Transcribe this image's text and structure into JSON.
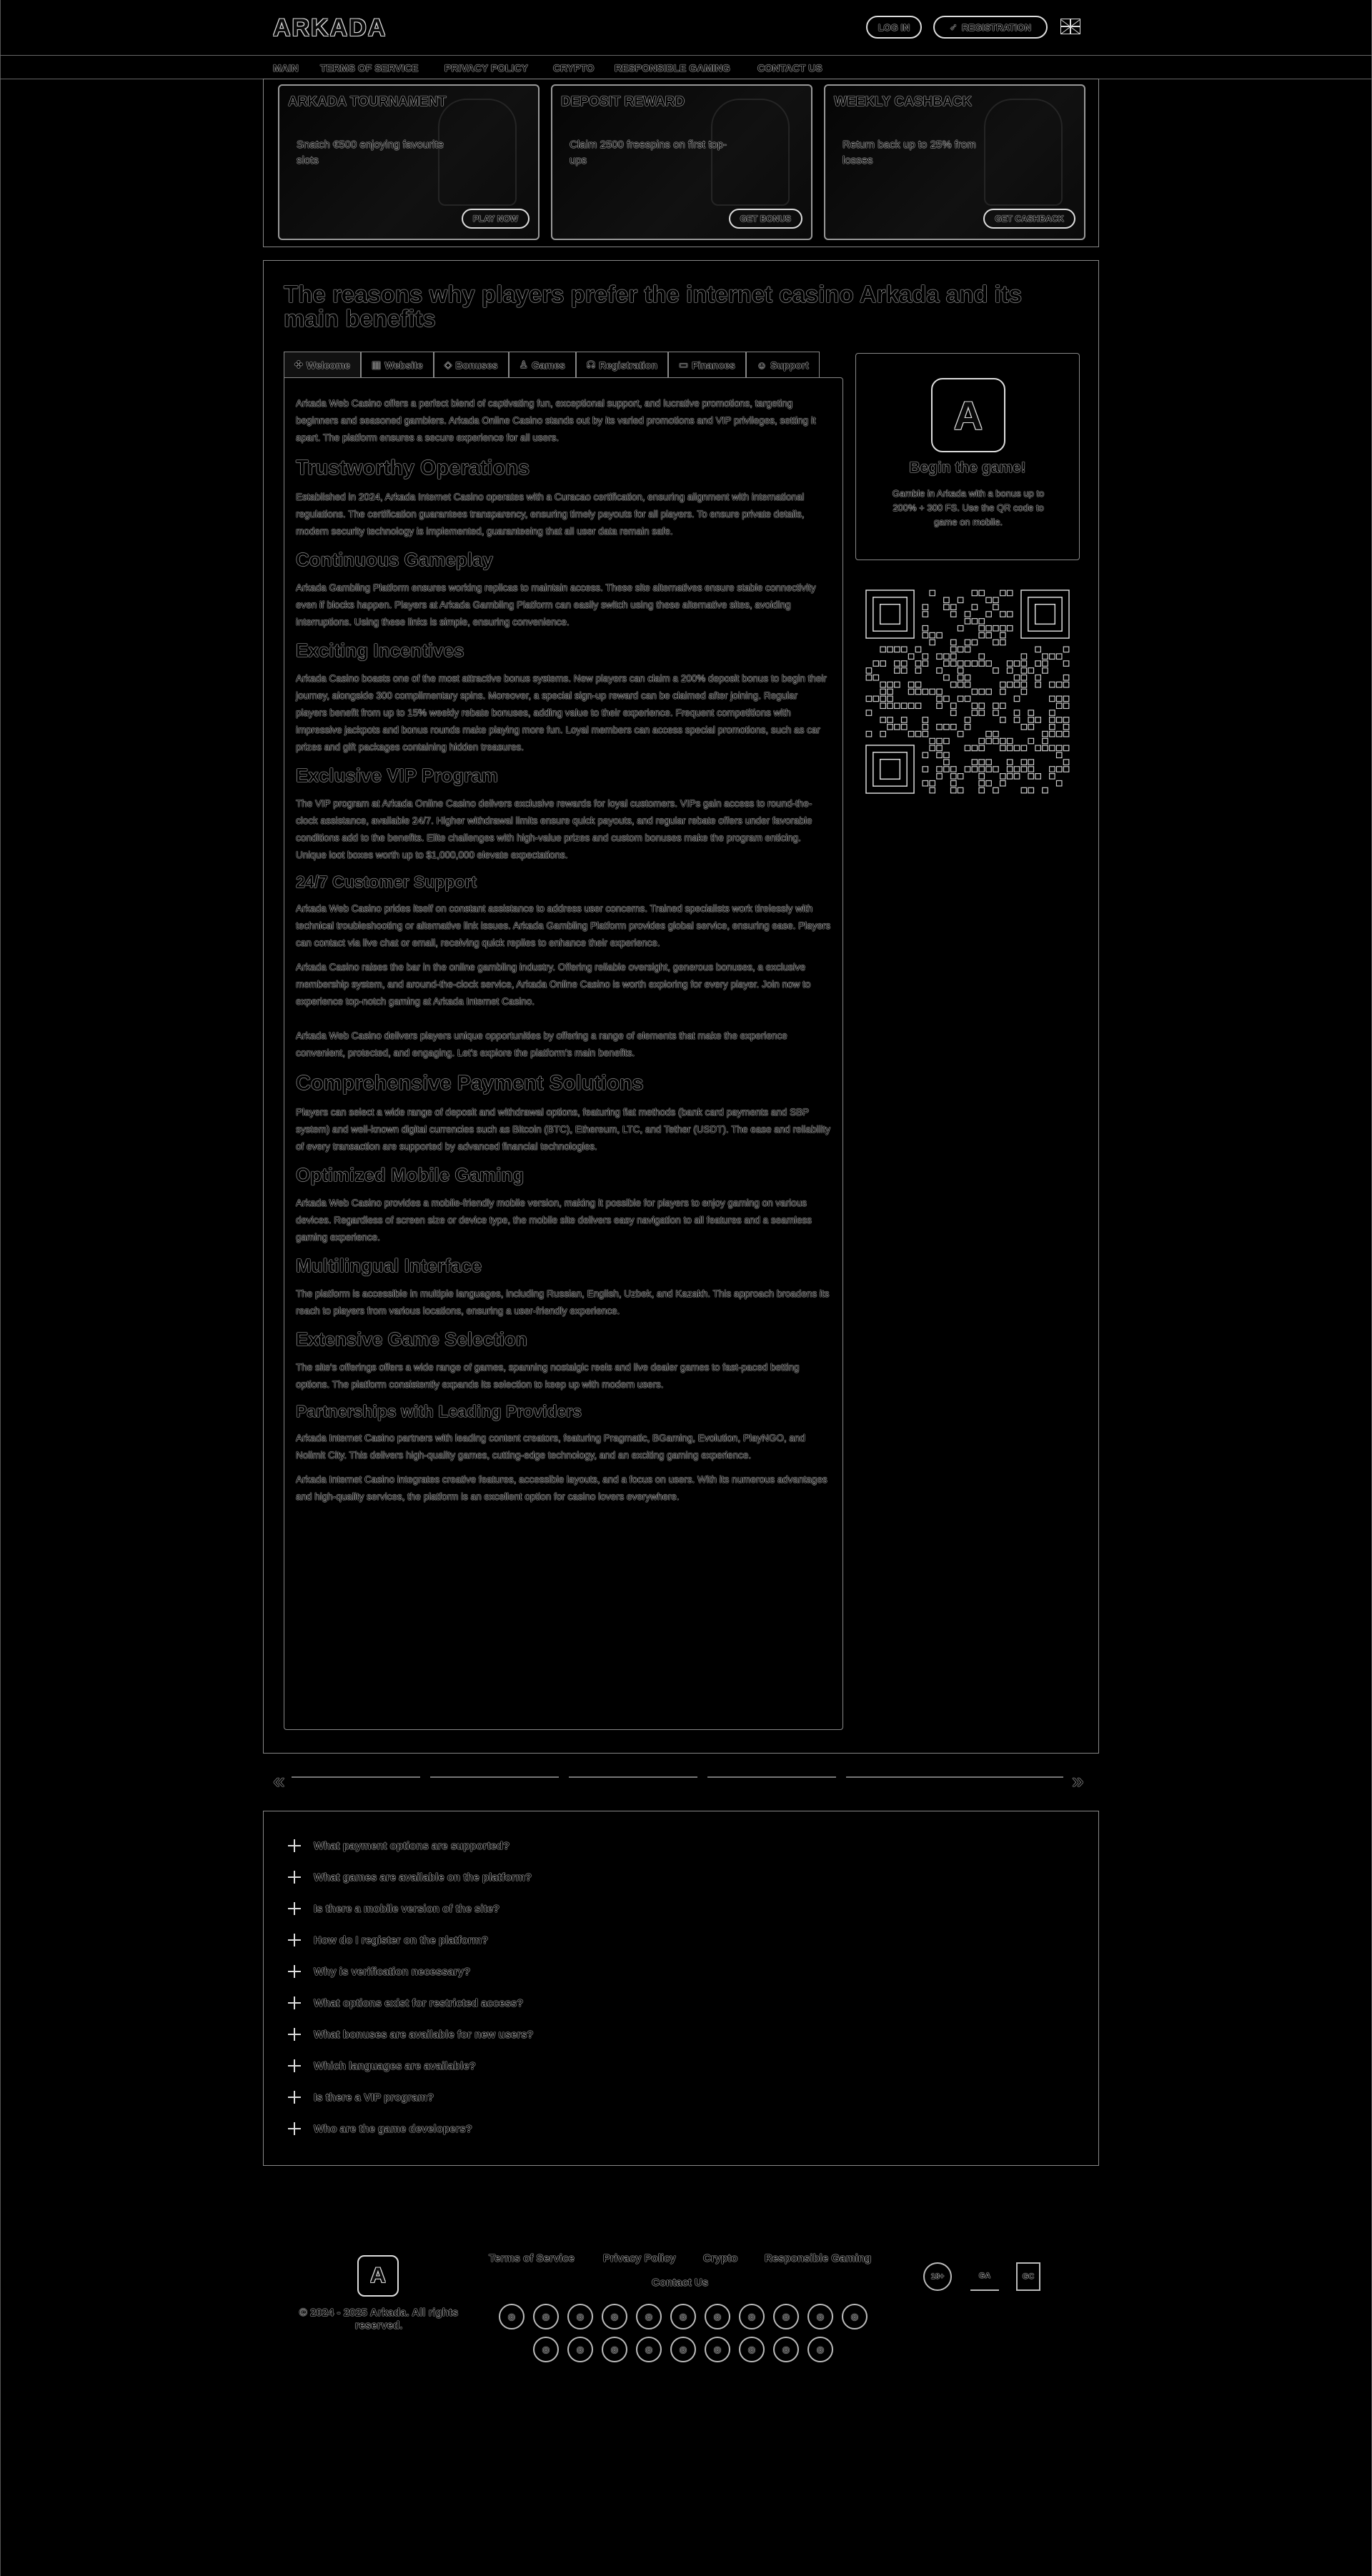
{
  "header": {
    "logo": "ARKADA",
    "login": "LOG IN",
    "register": "REGISTRATION"
  },
  "nav": {
    "items": [
      "Main",
      "Terms of Service",
      "Privacy Policy",
      "Crypto",
      "Responsible Gaming",
      "Contact Us"
    ]
  },
  "promos": [
    {
      "title": "ARKADA TOURNAMENT",
      "desc": "Snatch €500 enjoying favourite slots",
      "button": "PLAY NOW"
    },
    {
      "title": "DEPOSIT REWARD",
      "desc": "Claim 2500 freespins on first top-ups",
      "button": "GET BONUS"
    },
    {
      "title": "WEEKLY CASHBACK",
      "desc": "Return back up to 25% from losses",
      "button": "GET CASHBACK"
    }
  ],
  "main": {
    "title": "The reasons why players prefer the internet casino Arkada and its main benefits",
    "tabs": [
      "Welcome",
      "Website",
      "Bonuses",
      "Games",
      "Registration",
      "Finances",
      "Support"
    ],
    "intro": "Arkada Web Casino offers a perfect blend of captivating fun, exceptional support, and lucrative promotions, targeting beginners and seasoned gamblers. Arkada Online Casino stands out by its varied promotions and VIP privileges, setting it apart. The platform ensures a secure experience for all users.",
    "h_trust": "Trustworthy Operations",
    "p_trust": "Established in 2024, Arkada Internet Casino operates with a Curacao certification, ensuring alignment with international regulations. The certification guarantees transparency, ensuring timely payouts for all players. To ensure private details, modern security technology is implemented, guaranteeing that all user data remain safe.",
    "h_cont": "Continuous Gameplay",
    "p_cont": "Arkada Gambling Platform ensures working replicas to maintain access. These site alternatives ensure stable connectivity even if blocks happen. Players at Arkada Gambling Platform can easily switch using these alternative sites, avoiding interruptions. Using these links is simple, ensuring convenience.",
    "h_exc": "Exciting Incentives",
    "p_exc": "Arkada Casino boasts one of the most attractive bonus systems. New players can claim a 200% deposit bonus to begin their journey, alongside 300 complimentary spins. Moreover, a special sign-up reward can be claimed after joining. Regular players benefit from up to 15% weekly rebate bonuses, adding value to their experience. Frequent competitions with impressive jackpots and bonus rounds make playing more fun. Loyal members can access special promotions, such as car prizes and gift packages containing hidden treasures.",
    "h_vip": "Exclusive VIP Program",
    "p_vip": "The VIP program at Arkada Online Casino delivers exclusive rewards for loyal customers. VIPs gain access to round-the-clock assistance, available 24/7. Higher withdrawal limits ensure quick payouts, and regular rebate offers under favorable conditions add to the benefits. Elite challenges with high-value prizes and custom bonuses make the program enticing. Unique loot boxes worth up to $1,000,000 elevate expectations.",
    "h_sup": "24/7 Customer Support",
    "p_sup": "Arkada Web Casino prides itself on constant assistance to address user concerns. Trained specialists work tirelessly with technical troubleshooting or alternative link issues. Arkada Gambling Platform provides global service, ensuring ease. Players can contact via live chat or email, receiving quick replies to enhance their experience.",
    "p_bar": "Arkada Casino raises the bar in the online gambling industry. Offering reliable oversight, generous bonuses, a exclusive membership system, and around-the-clock service, Arkada Online Casino is worth exploring for every player. Join now to experience top-notch gaming at Arkada Internet Casino.",
    "p_uniq": "Arkada Web Casino delivers players unique opportunities by offering a range of elements that make the experience convenient, protected, and engaging. Let's explore the platform's main benefits.",
    "h_pay": "Comprehensive Payment Solutions",
    "p_pay": "Players can select a wide range of deposit and withdrawal options, featuring fiat methods (bank card payments and SBP system) and well-known digital currencies such as Bitcoin (BTC), Ethereum, LTC, and Tether (USDT). The ease and reliability of every transaction are supported by advanced financial technologies.",
    "h_mob": "Optimized Mobile Gaming",
    "p_mob": "Arkada Web Casino provides a mobile-friendly mobile version, making it possible for players to enjoy gaming on various devices. Regardless of screen size or device type, the mobile site delivers easy navigation to all features and a seamless gaming experience.",
    "h_lang": "Multilingual Interface",
    "p_lang": "The platform is accessible in multiple languages, including Russian, English, Uzbek, and Kazakh. This approach broadens its reach to players from various locations, ensuring a user-friendly experience.",
    "h_games": "Extensive Game Selection",
    "p_games": "The site's offerings offers a wide range of games, spanning nostalgic reels and live dealer games to fast-paced betting options. The platform consistently expands its selection to keep up with modern users.",
    "h_part": "Partnerships with Leading Providers",
    "p_part": "Arkada Internet Casino partners with leading content creators, featuring Pragmatic, BGaming, Evolution, PlayNGO, and Nolimit City. This delivers high-quality games, cutting-edge technology, and an exciting gaming experience.",
    "p_final": "Arkada Internet Casino integrates creative features, accessible layouts, and a focus on users. With its numerous advantages and high-quality services, the platform is an excellent option for casino lovers everywhere."
  },
  "side": {
    "title": "Begin the game!",
    "desc": "Gamble in Arkada with a bonus up to 200% + 300 FS. Use the QR code to game on mobile."
  },
  "faq": [
    "What payment options are supported?",
    "What games are available on the platform?",
    "Is there a mobile version of the site?",
    "How do I register on the platform?",
    "Why is verification necessary?",
    "What options exist for restricted access?",
    "What bonuses are available for new users?",
    "Which languages are available?",
    "Is there a VIP program?",
    "Who are the game developers?"
  ],
  "footer": {
    "copyright": "© 2024 - 2025 Arkada. All rights reserved.",
    "links": [
      "Terms of Service",
      "Privacy Policy",
      "Crypto",
      "Responsible Gaming",
      "Contact Us"
    ],
    "badges": [
      "18+",
      "GA",
      "GC"
    ]
  },
  "icons": {
    "tab_icons": [
      "clover-icon",
      "chart-icon",
      "ticket-icon",
      "joystick-icon",
      "headset-icon",
      "wallet-icon",
      "support-icon"
    ],
    "payments_row1": [
      "coin-1",
      "coin-2",
      "coin-3",
      "coin-4",
      "coin-5",
      "coin-6",
      "coin-7",
      "coin-8",
      "coin-9",
      "coin-10",
      "coin-11"
    ],
    "payments_row2": [
      "pay-1",
      "pay-2",
      "pay-3",
      "pay-4",
      "pay-5",
      "pay-6",
      "pay-7",
      "pay-8",
      "pay-9"
    ]
  }
}
